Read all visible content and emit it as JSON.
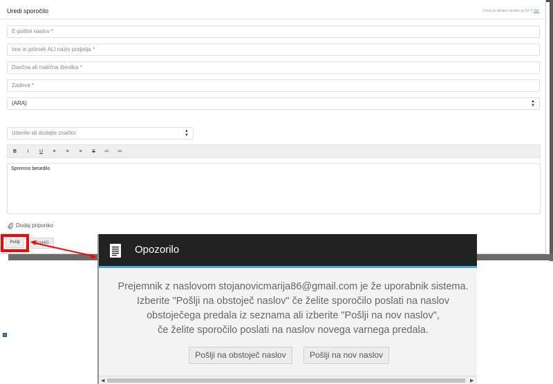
{
  "form": {
    "title": "Uredi sporočilo",
    "cost_text": "Cena za izbrano storitev je 0.6 €",
    "cost_link": "Več",
    "email_placeholder": "E-poštni naslov *",
    "name_placeholder": "Ime in priimek ALI naziv podjetja *",
    "tax_placeholder": "Davčna ali matična številka *",
    "subject_placeholder": "Zadeva *",
    "institution_value": "(ARA)",
    "tag_placeholder": "Izberite ali dodajte značko",
    "editor_text": "Spremno besedilo",
    "attach_label": "Dodaj priponko",
    "send_label": "Pošlji",
    "cancel_label": "Prekliči",
    "toolbar": [
      "B",
      "I",
      "U",
      "≡",
      "≡",
      "≡",
      "S",
      "≔",
      "≔"
    ]
  },
  "modal": {
    "title": "Opozorilo",
    "lines": [
      "Prejemnik z naslovom stojanovicmarija86@gmail.com je že uporabnik sistema.",
      "Izberite \"Pošlji na obstoječ naslov\" če želite sporočilo poslati na naslov",
      "obstoječega predala iz seznama ali izberite \"Pošlji na nov naslov\",",
      "če želite sporočilo poslati na naslov novega varnega predala."
    ],
    "btn_existing": "Pošlji na obstoječ naslov",
    "btn_new": "Pošlji na nov naslov"
  },
  "colors": {
    "highlight": "#ff0000",
    "modal_header": "#222222",
    "modal_accent": "#3aaee0"
  }
}
